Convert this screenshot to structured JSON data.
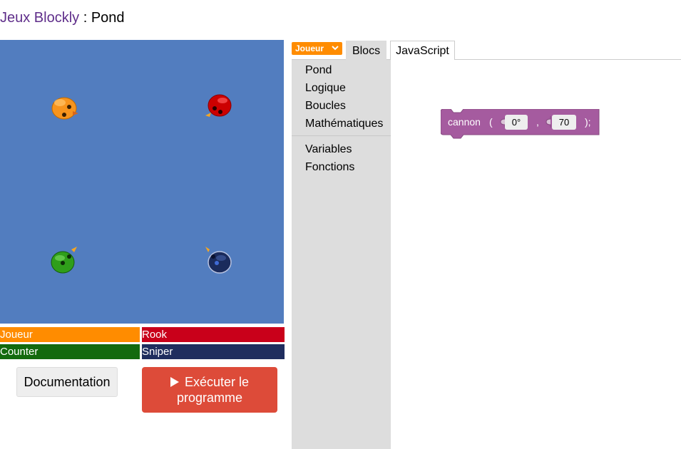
{
  "header": {
    "app_link": "Jeux Blockly",
    "separator": " : ",
    "page": "Pond"
  },
  "ducks": [
    {
      "name": "Joueur",
      "color": "#ff8c00"
    },
    {
      "name": "Rook",
      "color": "#cc0000"
    },
    {
      "name": "Counter",
      "color": "#166c0b"
    },
    {
      "name": "Sniper",
      "color": "#1a2b5c"
    }
  ],
  "legend": [
    {
      "label": "Joueur",
      "color": "#ff8c00"
    },
    {
      "label": "Rook",
      "color": "#c9001a"
    },
    {
      "label": "Counter",
      "color": "#136a0e"
    },
    {
      "label": "Sniper",
      "color": "#1f2d5e"
    }
  ],
  "buttons": {
    "documentation": "Documentation",
    "run_line1": "Exécuter le",
    "run_line2": "programme"
  },
  "editor": {
    "player_select": "Joueur",
    "tabs": {
      "blocks": "Blocs",
      "javascript": "JavaScript"
    },
    "toolbox": [
      "Pond",
      "Logique",
      "Boucles",
      "Mathématiques",
      "Variables",
      "Fonctions"
    ]
  },
  "block": {
    "name": "cannon",
    "open": "(",
    "comma": ",",
    "close": ");",
    "angle": "0°",
    "range": "70",
    "color": "#a55b9f"
  }
}
